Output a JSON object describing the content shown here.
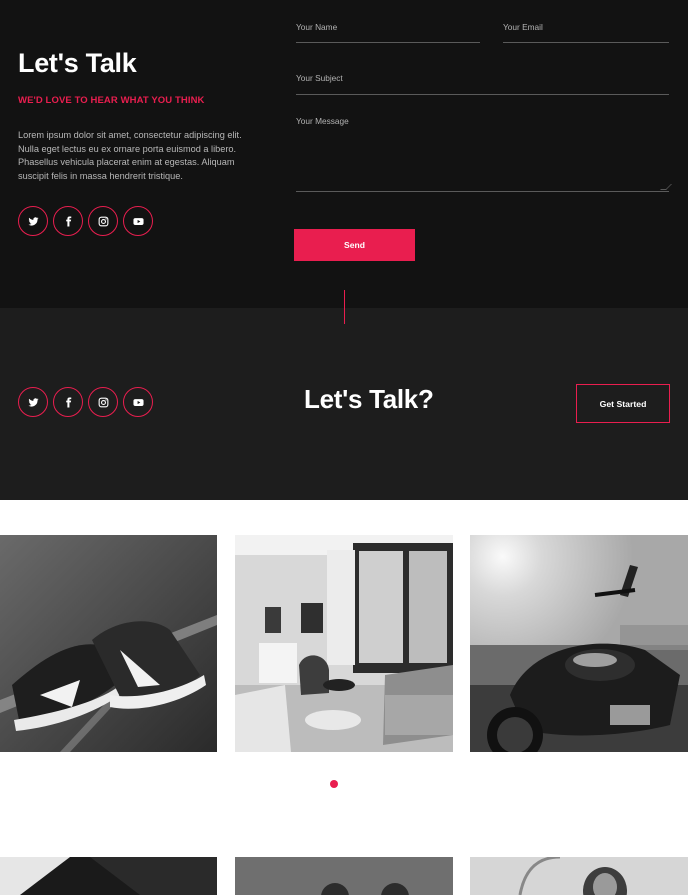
{
  "contact": {
    "title": "Let's Talk",
    "tagline": "WE'D LOVE TO HEAR WHAT YOU THINK",
    "body": "Lorem ipsum dolor sit amet, consectetur adipiscing elit. Nulla eget lectus eu ex ornare porta euismod a libero. Phasellus vehicula placerat enim at egestas. Aliquam suscipit felis in massa hendrerit tristique.",
    "social": [
      "twitter-icon",
      "facebook-icon",
      "instagram-icon",
      "youtube-icon"
    ]
  },
  "form": {
    "name_label": "Your Name",
    "email_label": "Your Email",
    "subject_label": "Your Subject",
    "message_label": "Your Message",
    "send_label": "Send"
  },
  "cta": {
    "title": "Let's Talk?",
    "button_label": "Get Started"
  },
  "gallery": {
    "photos": [
      "sneakers-photo",
      "living-room-photo",
      "motorcycle-photo",
      "gallery-photo-4",
      "gallery-photo-5",
      "gallery-photo-6"
    ],
    "slider": {
      "pages": 1,
      "active": 1
    }
  },
  "colors": {
    "accent": "#e91e4f",
    "dark_bg": "#121212",
    "cta_bg": "#1d1d1d",
    "text_light": "#ffffff",
    "text_muted": "#b8b8b8"
  }
}
